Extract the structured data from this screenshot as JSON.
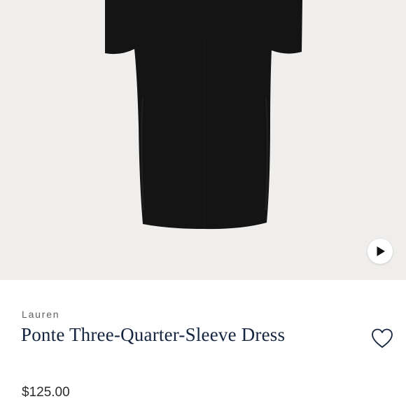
{
  "product": {
    "brand": "Lauren",
    "title": "Ponte Three-Quarter-Sleeve Dress",
    "price": "$125.00"
  },
  "media": {
    "image_subject": "black three-quarter-sleeve dress",
    "play_icon": "play-icon",
    "background_color": "#efeeec",
    "garment_color": "#141414"
  },
  "actions": {
    "wishlist_icon": "heart-outline-icon"
  },
  "colors": {
    "title_color": "#15253f",
    "brand_color": "#5f5f5f",
    "price_color": "#2b2b2b"
  }
}
